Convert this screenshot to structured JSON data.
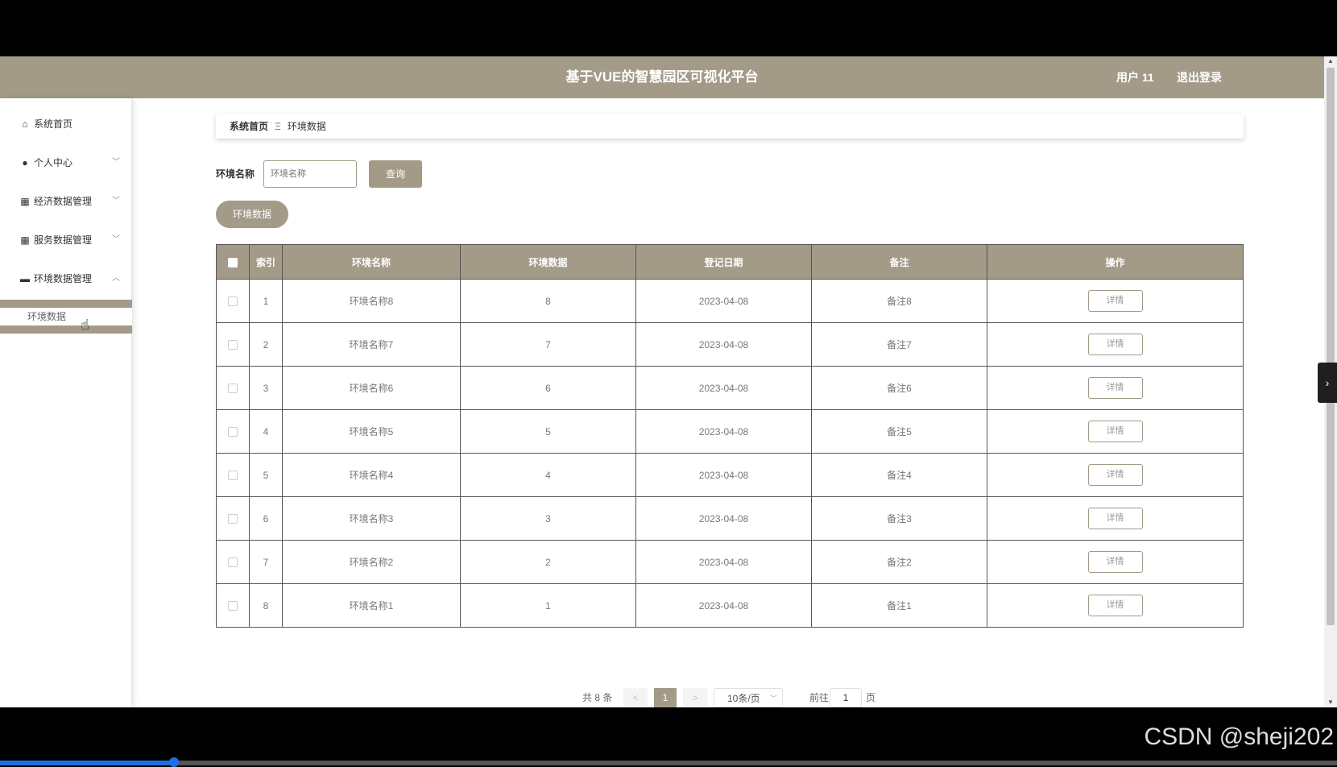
{
  "header": {
    "title": "基于VUE的智慧园区可视化平台",
    "user": "用户 11",
    "logout": "退出登录"
  },
  "sidebar": {
    "items": [
      {
        "label": "系统首页",
        "icon": "home-icon"
      },
      {
        "label": "个人中心",
        "icon": "user-icon"
      },
      {
        "label": "经济数据管理",
        "icon": "grid-icon"
      },
      {
        "label": "服务数据管理",
        "icon": "grid-icon"
      },
      {
        "label": "环境数据管理",
        "icon": "monitor-icon"
      }
    ],
    "sub_item": "环境数据"
  },
  "breadcrumb": {
    "home": "系统首页",
    "separator": "Ξ",
    "current": "环境数据"
  },
  "search": {
    "label": "环境名称",
    "placeholder": "环境名称",
    "button": "查询"
  },
  "tag_button": "环境数据",
  "table": {
    "headers": [
      "索引",
      "环境名称",
      "环境数据",
      "登记日期",
      "备注",
      "操作"
    ],
    "detail_label": "详情",
    "rows": [
      {
        "index": "1",
        "name": "环境名称8",
        "value": "8",
        "date": "2023-04-08",
        "note": "备注8"
      },
      {
        "index": "2",
        "name": "环境名称7",
        "value": "7",
        "date": "2023-04-08",
        "note": "备注7"
      },
      {
        "index": "3",
        "name": "环境名称6",
        "value": "6",
        "date": "2023-04-08",
        "note": "备注6"
      },
      {
        "index": "4",
        "name": "环境名称5",
        "value": "5",
        "date": "2023-04-08",
        "note": "备注5"
      },
      {
        "index": "5",
        "name": "环境名称4",
        "value": "4",
        "date": "2023-04-08",
        "note": "备注4"
      },
      {
        "index": "6",
        "name": "环境名称3",
        "value": "3",
        "date": "2023-04-08",
        "note": "备注3"
      },
      {
        "index": "7",
        "name": "环境名称2",
        "value": "2",
        "date": "2023-04-08",
        "note": "备注2"
      },
      {
        "index": "8",
        "name": "环境名称1",
        "value": "1",
        "date": "2023-04-08",
        "note": "备注1"
      }
    ]
  },
  "pagination": {
    "total": "共 8 条",
    "prev": "<",
    "current": "1",
    "next": ">",
    "page_size": "10条/页",
    "goto": "前往",
    "goto_value": "1",
    "page_unit": "页"
  },
  "watermark": "CSDN @sheji202",
  "video_progress": 0.13,
  "colors": {
    "accent": "#a39a88"
  }
}
